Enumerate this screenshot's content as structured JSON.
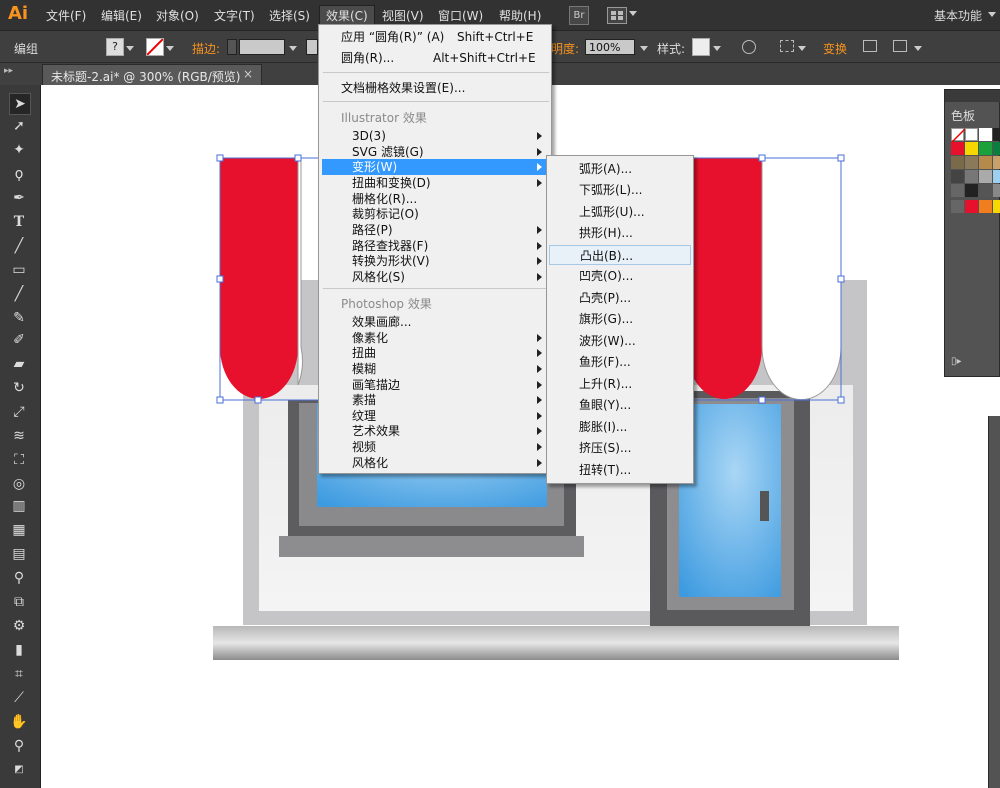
{
  "app": {
    "logo": "Ai",
    "workspace": "基本功能",
    "bridge_label": "Br"
  },
  "menubar": [
    "文件(F)",
    "编辑(E)",
    "对象(O)",
    "文字(T)",
    "选择(S)",
    "效果(C)",
    "视图(V)",
    "窗口(W)",
    "帮助(H)"
  ],
  "controlbar": {
    "group_label": "编组",
    "stroke_label": "描边:",
    "opacity_label": "明度:",
    "opacity_value": "100%",
    "style_label": "样式:",
    "transform_label": "变换"
  },
  "document_tab": {
    "title": "未标题-2.ai* @ 300% (RGB/预览)",
    "close": "×"
  },
  "effect_menu": {
    "apply_label": "应用 “圆角(R)” (A)",
    "apply_shortcut": "Shift+Ctrl+E",
    "last_label": "圆角(R)...",
    "last_shortcut": "Alt+Shift+Ctrl+E",
    "raster_settings": "文档栅格效果设置(E)...",
    "illustrator_header": "Illustrator 效果",
    "illustrator_items": [
      "3D(3)",
      "SVG 滤镜(G)",
      "变形(W)",
      "扭曲和变换(D)",
      "栅格化(R)...",
      "裁剪标记(O)",
      "路径(P)",
      "路径查找器(F)",
      "转换为形状(V)",
      "风格化(S)"
    ],
    "photoshop_header": "Photoshop 效果",
    "photoshop_items": [
      "效果画廊...",
      "像素化",
      "扭曲",
      "模糊",
      "画笔描边",
      "素描",
      "纹理",
      "艺术效果",
      "视频",
      "风格化"
    ]
  },
  "warp_submenu": [
    "弧形(A)...",
    "下弧形(L)...",
    "上弧形(U)...",
    "拱形(H)...",
    "凸出(B)...",
    "凹壳(O)...",
    "凸壳(P)...",
    "旗形(G)...",
    "波形(W)...",
    "鱼形(F)...",
    "上升(R)...",
    "鱼眼(Y)...",
    "膨胀(I)...",
    "挤压(S)...",
    "扭转(T)..."
  ],
  "swatches_panel": {
    "title": "色板"
  },
  "colors": {
    "awning_red": "#e8112d",
    "window_blue": "#4aa8e8",
    "menu_highlight": "#3399ff",
    "selection": "#4a6fd8"
  }
}
